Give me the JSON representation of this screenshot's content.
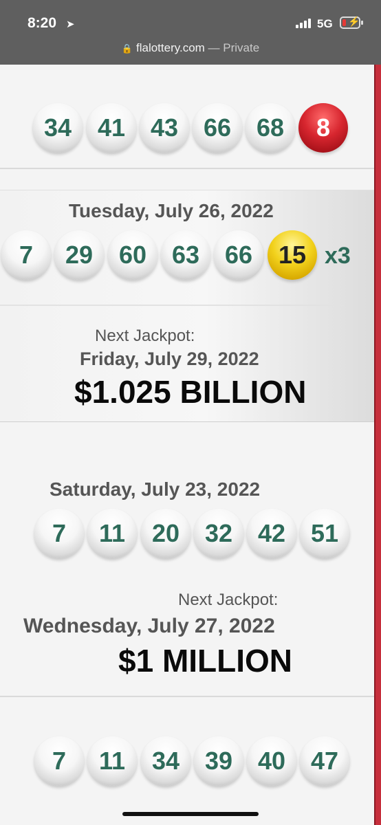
{
  "status": {
    "time": "8:20",
    "network": "5G",
    "url": "flalottery.com",
    "url_suffix": "— Private"
  },
  "draws": [
    {
      "balls": [
        "34",
        "41",
        "43",
        "66",
        "68"
      ],
      "special": "8",
      "special_color": "#d7262f"
    },
    {
      "date": "Tuesday, July 26, 2022",
      "balls": [
        "7",
        "29",
        "60",
        "63",
        "66"
      ],
      "special": "15",
      "special_color": "#f2d21d",
      "multiplier": "x3",
      "next_label": "Next Jackpot:",
      "next_date": "Friday, July 29, 2022",
      "jackpot": "$1.025 BILLION"
    },
    {
      "date": "Saturday, July 23, 2022",
      "balls": [
        "7",
        "11",
        "20",
        "32",
        "42",
        "51"
      ],
      "next_label": "Next Jackpot:",
      "next_date": "Wednesday, July 27, 2022",
      "jackpot": "$1 MILLION"
    },
    {
      "balls": [
        "7",
        "11",
        "34",
        "39",
        "40",
        "47"
      ]
    }
  ],
  "colors": {
    "number_green": "#2e6b5a",
    "accent_red": "#c62e3b",
    "status_bar": "#5f5f5f"
  }
}
